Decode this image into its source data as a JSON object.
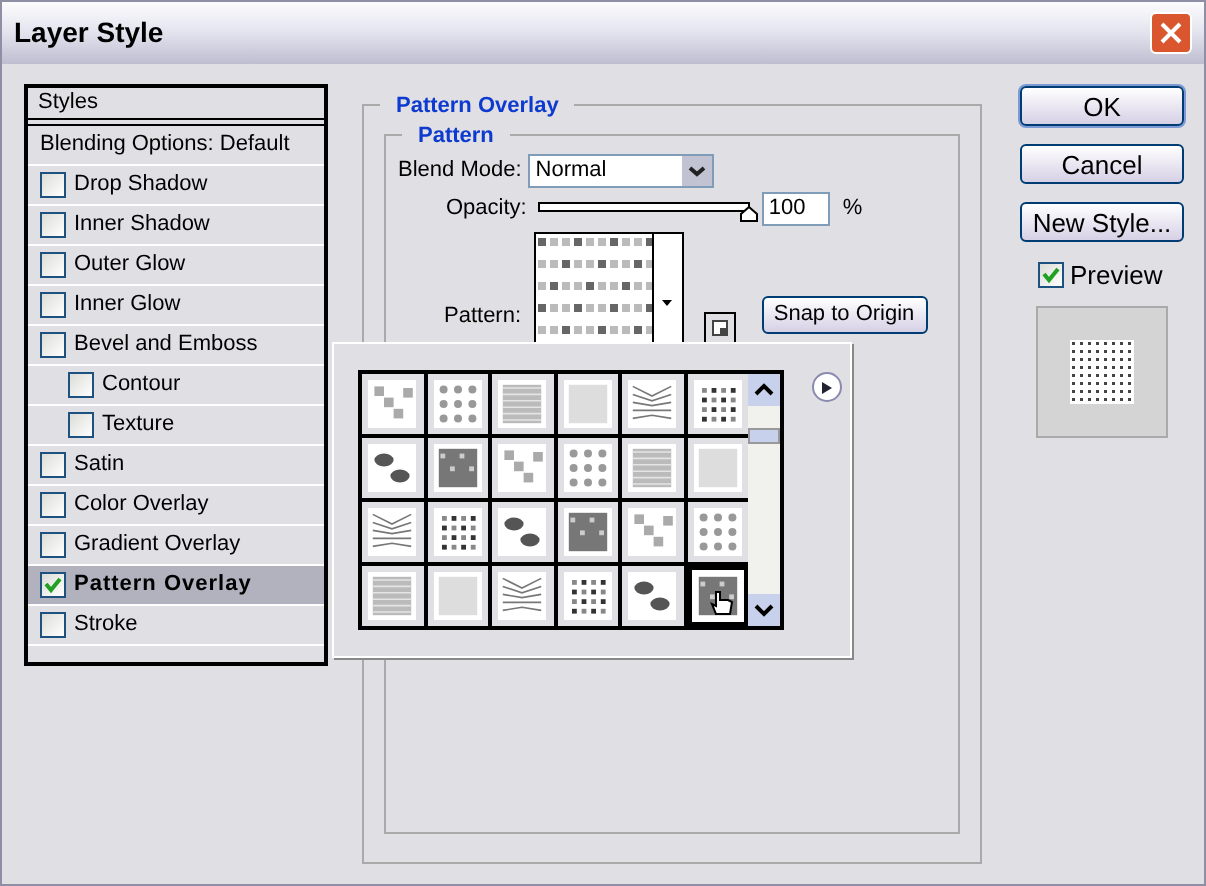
{
  "window": {
    "title": "Layer Style"
  },
  "styles": {
    "header": "Styles",
    "items": [
      {
        "label": "Blending Options: Default",
        "kind": "plain",
        "selected": false
      },
      {
        "label": "Drop Shadow",
        "kind": "check",
        "checked": false,
        "selected": false
      },
      {
        "label": "Inner Shadow",
        "kind": "check",
        "checked": false,
        "selected": false
      },
      {
        "label": "Outer Glow",
        "kind": "check",
        "checked": false,
        "selected": false
      },
      {
        "label": "Inner Glow",
        "kind": "check",
        "checked": false,
        "selected": false
      },
      {
        "label": "Bevel and Emboss",
        "kind": "check",
        "checked": false,
        "selected": false,
        "children": [
          {
            "label": "Contour",
            "kind": "check",
            "checked": false,
            "selected": false
          },
          {
            "label": "Texture",
            "kind": "check",
            "checked": false,
            "selected": false
          }
        ]
      },
      {
        "label": "Satin",
        "kind": "check",
        "checked": false,
        "selected": false
      },
      {
        "label": "Color Overlay",
        "kind": "check",
        "checked": false,
        "selected": false
      },
      {
        "label": "Gradient Overlay",
        "kind": "check",
        "checked": false,
        "selected": false
      },
      {
        "label": "Pattern Overlay",
        "kind": "check",
        "checked": true,
        "selected": true
      },
      {
        "label": "Stroke",
        "kind": "check",
        "checked": false,
        "selected": false
      }
    ]
  },
  "panel": {
    "title": "Pattern Overlay",
    "group": "Pattern",
    "blend_mode": {
      "label": "Blend Mode:",
      "value": "Normal"
    },
    "opacity": {
      "label": "Opacity:",
      "level": 1,
      "value": "100",
      "unit": "%"
    },
    "pattern": {
      "label": "Pattern:"
    },
    "snap_button": "Snap to Origin"
  },
  "picker": {
    "patterns": [
      {
        "selected": false
      },
      {
        "selected": false
      },
      {
        "selected": false
      },
      {
        "selected": false
      },
      {
        "selected": false
      },
      {
        "selected": false
      },
      {
        "selected": false
      },
      {
        "selected": false
      },
      {
        "selected": false
      },
      {
        "selected": false
      },
      {
        "selected": false
      },
      {
        "selected": false
      },
      {
        "selected": false
      },
      {
        "selected": false
      },
      {
        "selected": false
      },
      {
        "selected": false
      },
      {
        "selected": false
      },
      {
        "selected": false
      },
      {
        "selected": false
      },
      {
        "selected": false
      },
      {
        "selected": false
      },
      {
        "selected": false
      },
      {
        "selected": false
      },
      {
        "selected": true
      }
    ]
  },
  "buttons": [
    {
      "label": "OK",
      "kind": "default"
    },
    {
      "label": "Cancel",
      "kind": "normal"
    },
    {
      "label": "New Style...",
      "kind": "normal"
    }
  ],
  "preview": {
    "label": "Preview",
    "checked": true
  }
}
